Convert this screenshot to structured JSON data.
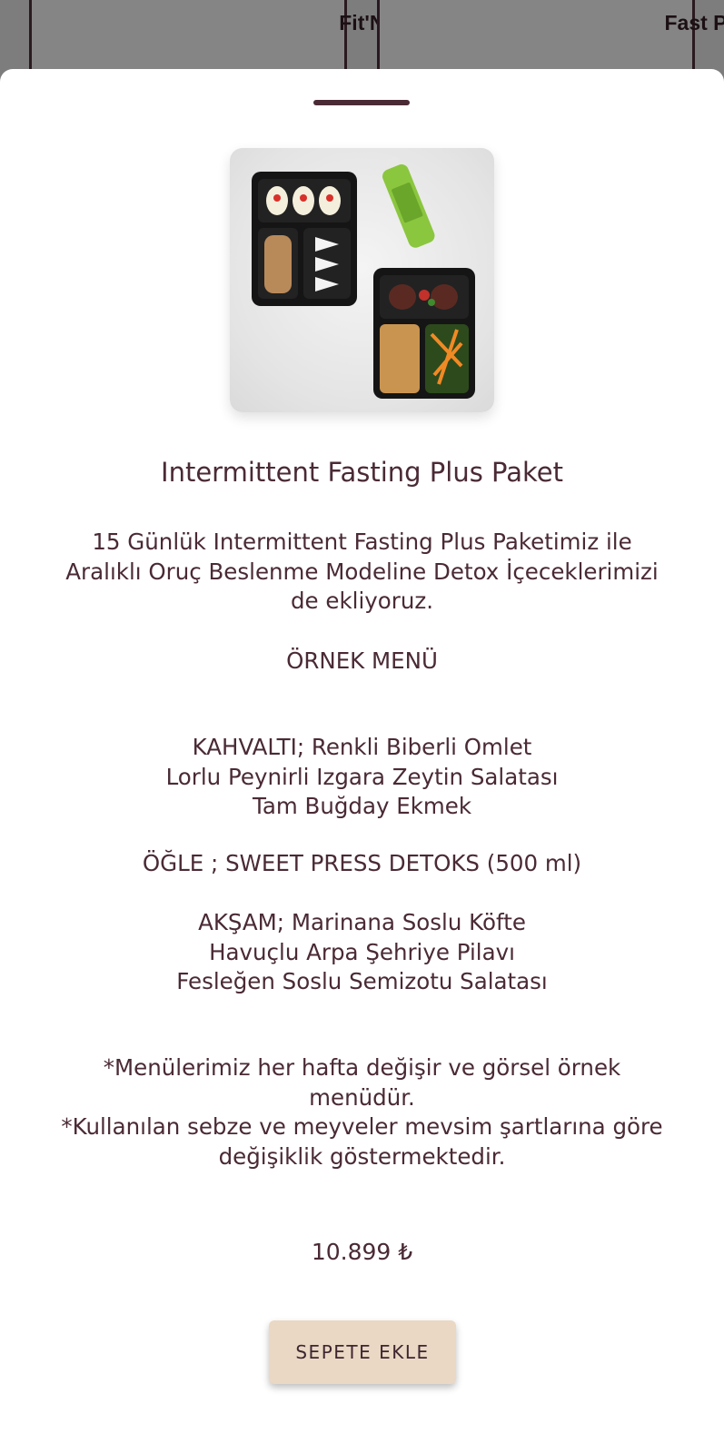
{
  "background": {
    "cards": [
      {
        "title": "Fit'N Detox"
      },
      {
        "title": "Fast Plus Paket"
      }
    ]
  },
  "product": {
    "title": "Intermittent Fasting Plus Paket",
    "image_alt": "meal-boxes-with-green-juice",
    "description": [
      "15 Günlük Intermittent Fasting Plus Paketimiz ile",
      "Aralıklı Oruç Beslenme Modeline Detox İçeceklerimizi",
      "de ekliyoruz."
    ],
    "sample_menu_heading": "ÖRNEK MENÜ",
    "breakfast": [
      "KAHVALTI; Renkli Biberli Omlet",
      "Lorlu Peynirli Izgara Zeytin Salatası",
      "Tam Buğday Ekmek"
    ],
    "lunch": [
      "ÖĞLE ; SWEET PRESS DETOKS (500 ml)"
    ],
    "dinner": [
      "AKŞAM; Marinana Soslu Köfte",
      "Havuçlu Arpa Şehriye Pilavı",
      "Fesleğen Soslu Semizotu Salatası"
    ],
    "notes": [
      "*Menülerimiz her hafta değişir ve görsel örnek",
      "menüdür.",
      "*Kullanılan sebze ve meyveler mevsim şartlarına göre",
      "değişiklik göstermektedir."
    ],
    "price": "10.899 ₺",
    "add_to_cart_label": "SEPETE EKLE"
  },
  "colors": {
    "text": "#4a2a35",
    "button_bg": "#ead8c4",
    "overlay": "#7d7d7d"
  }
}
